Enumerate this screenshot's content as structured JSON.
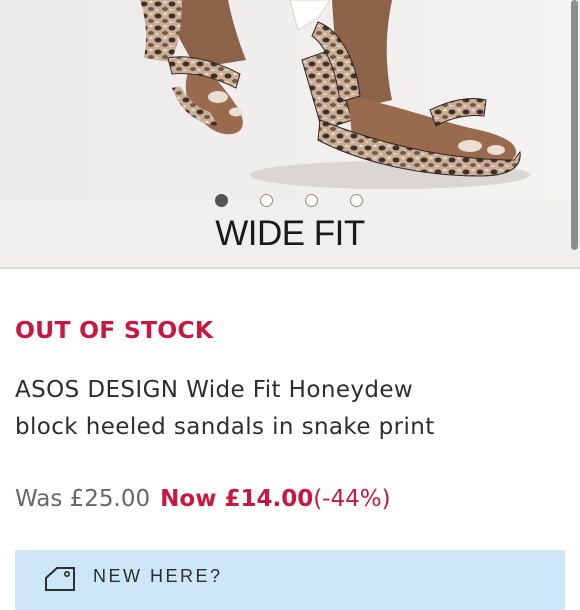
{
  "gallery": {
    "image_alt": "Snake print block heeled sandals worn on feet",
    "slide_count": 4,
    "active_slide": 1,
    "fit_label": "WIDE FIT"
  },
  "product": {
    "stock_status": "OUT OF STOCK",
    "title_line1": "ASOS DESIGN Wide Fit Honeydew",
    "title_line2": "block heeled sandals in snake print",
    "was_price": "Was £25.00",
    "now_price": "Now £14.00",
    "discount": "(-44%)"
  },
  "banner": {
    "text": "NEW HERE?",
    "icon": "tag-icon"
  },
  "colors": {
    "sale_red": "#c8183f",
    "banner_blue": "#cde6f7"
  }
}
